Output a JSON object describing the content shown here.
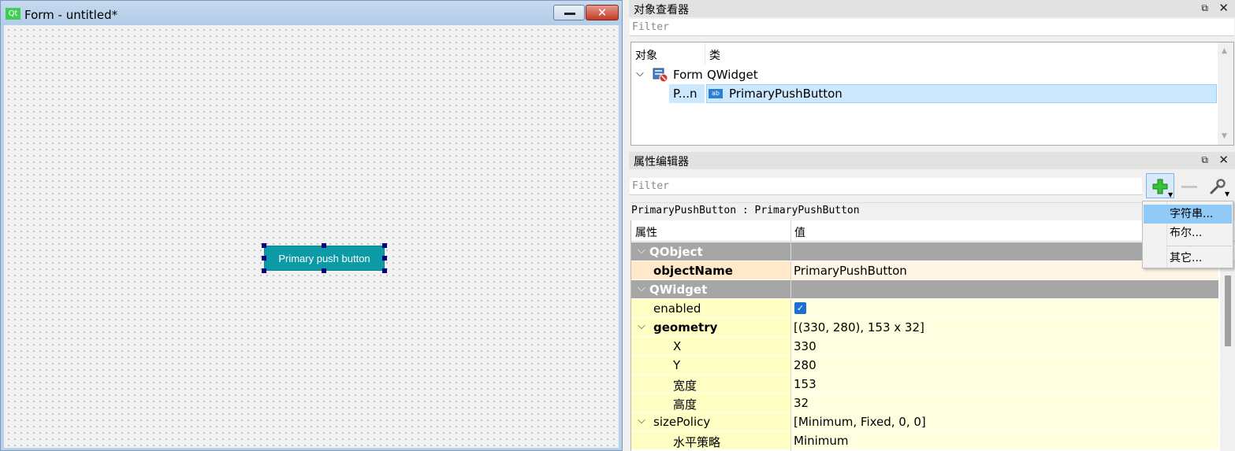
{
  "form_window": {
    "logo": "Qt",
    "title": "Form - untitled*",
    "close_glyph": "✕",
    "preview_button_label": "Primary push button",
    "preview_button_color": "#0c9ba6"
  },
  "object_inspector": {
    "title": "对象查看器",
    "filter_placeholder": "Filter",
    "columns": [
      "对象",
      "类"
    ],
    "rows": [
      {
        "object": "Form",
        "class": "QWidget",
        "icon": "form-widget-icon"
      },
      {
        "object": "P...n",
        "class": "PrimaryPushButton",
        "icon": "push-button-icon",
        "icon_text": "ab"
      }
    ]
  },
  "property_editor": {
    "title": "属性编辑器",
    "filter_placeholder": "Filter",
    "class_label": "PrimaryPushButton : PrimaryPushButton",
    "columns": [
      "属性",
      "值"
    ],
    "groups": {
      "qobject": "QObject",
      "qwidget": "QWidget"
    },
    "props": {
      "objectName": {
        "name": "objectName",
        "value": "PrimaryPushButton"
      },
      "enabled": {
        "name": "enabled",
        "checked": true,
        "check_glyph": "✓"
      },
      "geometry": {
        "name": "geometry",
        "value": "[(330, 280), 153 x 32]"
      },
      "x": {
        "name": "X",
        "value": "330"
      },
      "y": {
        "name": "Y",
        "value": "280"
      },
      "width": {
        "name": "宽度",
        "value": "153"
      },
      "height": {
        "name": "高度",
        "value": "32"
      },
      "sizePolicy": {
        "name": "sizePolicy",
        "value": "[Minimum, Fixed, 0, 0]"
      },
      "hpolicy": {
        "name": "水平策略",
        "value": "Minimum"
      }
    },
    "add_menu": {
      "items": [
        "字符串...",
        "布尔...",
        "其它..."
      ]
    }
  },
  "colors": {
    "group_bg": "#a6a6a6",
    "yellow_row": "#ffffc4",
    "selected_row": "#cce8ff",
    "menu_highlight": "#91c9f7"
  }
}
